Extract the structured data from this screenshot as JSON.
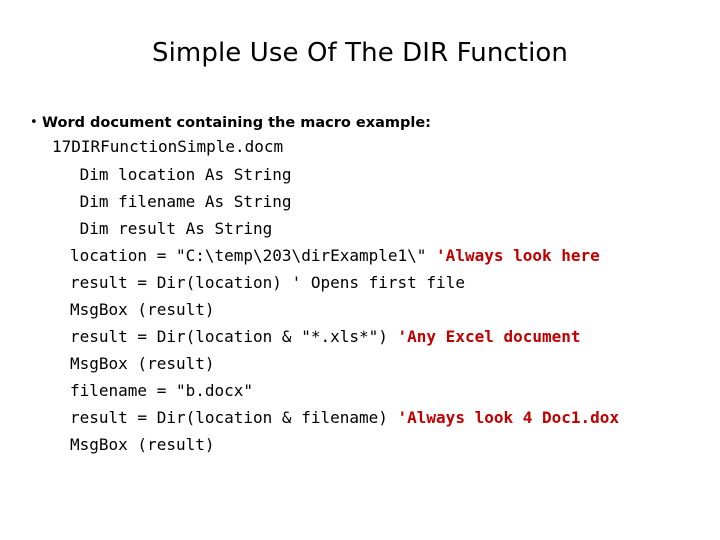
{
  "slide": {
    "title": "Simple Use Of The DIR Function",
    "background_color": "#FFFFFF",
    "text_color": "#000000",
    "comment_color": "#C00000"
  },
  "bullet": {
    "marker": "•",
    "text": "Word document containing the macro example:",
    "filename": "17DIRFunctionSimple.docm"
  },
  "code": {
    "lines": [
      {
        "code": " Dim location As String",
        "comment": "",
        "comment_style": "none"
      },
      {
        "code": " Dim filename As String",
        "comment": "",
        "comment_style": "none"
      },
      {
        "code": " Dim result As String",
        "comment": "",
        "comment_style": "none"
      },
      {
        "code": "location = \"C:\\temp\\203\\dirExample1\\\" ",
        "comment": "'Always look here",
        "comment_style": "red"
      },
      {
        "code": "result = Dir(location) ",
        "comment": "' Opens first file",
        "comment_style": "plain"
      },
      {
        "code": "MsgBox (result)",
        "comment": "",
        "comment_style": "none"
      },
      {
        "code": "result = Dir(location & \"*.xls*\") ",
        "comment": "'Any Excel document",
        "comment_style": "red"
      },
      {
        "code": "MsgBox (result)",
        "comment": "",
        "comment_style": "none"
      },
      {
        "code": "filename = \"b.docx\"",
        "comment": "",
        "comment_style": "none"
      },
      {
        "code": "result = Dir(location & filename) ",
        "comment": "'Always look 4 Doc1.dox",
        "comment_style": "red"
      },
      {
        "code": "MsgBox (result)",
        "comment": "",
        "comment_style": "none"
      }
    ]
  }
}
